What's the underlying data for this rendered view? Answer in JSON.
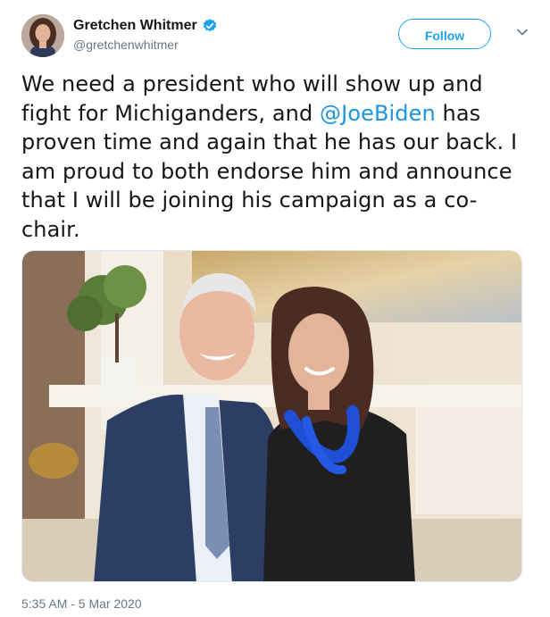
{
  "author": {
    "display_name": "Gretchen Whitmer",
    "handle": "@gretchenwhitmer",
    "verified": true
  },
  "actions": {
    "follow_label": "Follow"
  },
  "tweet": {
    "text_before": "We need a president who will show up and fight for Michiganders, and ",
    "mention": "@JoeBiden",
    "text_after": " has proven time and again that he has our back. I am proud to both endorse him and announce that I will be joining his campaign as a co-chair.",
    "timestamp": "5:35 AM - 5 Mar 2020"
  },
  "colors": {
    "accent": "#1da1f2",
    "mention": "#1b95e0",
    "secondary_text": "#657786"
  },
  "icons": {
    "verified": "verified-badge-icon",
    "caret": "chevron-down-icon"
  }
}
